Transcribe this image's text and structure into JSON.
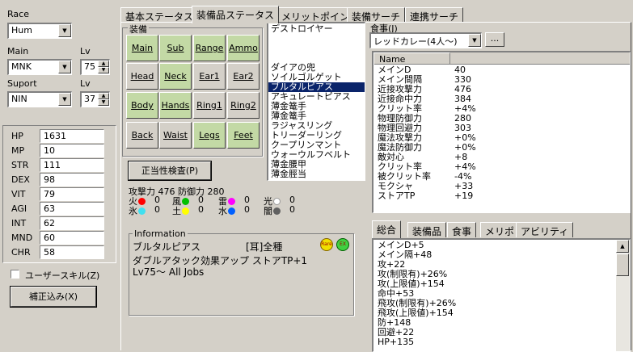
{
  "left": {
    "race_label": "Race",
    "race_value": "Hum",
    "main_label": "Main",
    "main_value": "MNK",
    "main_lv_label": "Lv",
    "main_lv_value": "75",
    "support_label": "Suport",
    "support_value": "NIN",
    "support_lv_label": "Lv",
    "support_lv_value": "37",
    "stats": [
      {
        "name": "HP",
        "value": "1631"
      },
      {
        "name": "MP",
        "value": "10"
      },
      {
        "name": "STR",
        "value": "111"
      },
      {
        "name": "DEX",
        "value": "98"
      },
      {
        "name": "VIT",
        "value": "79"
      },
      {
        "name": "AGI",
        "value": "63"
      },
      {
        "name": "INT",
        "value": "62"
      },
      {
        "name": "MND",
        "value": "60"
      },
      {
        "name": "CHR",
        "value": "58"
      }
    ],
    "user_skill_label": "ユーザースキル(Z)",
    "correction_button": "補正込み(X)"
  },
  "tabs": [
    "基本ステータス",
    "装備品ステータス",
    "メリットポイント",
    "装備サーチ",
    "連携サーチ"
  ],
  "equip": {
    "group_label": "装備",
    "slots": [
      {
        "label": "Main",
        "state": "equipped"
      },
      {
        "label": "Sub",
        "state": "equipped"
      },
      {
        "label": "Range",
        "state": "equipped"
      },
      {
        "label": "Ammo",
        "state": "equipped"
      },
      {
        "label": "Head",
        "state": "empty"
      },
      {
        "label": "Neck",
        "state": "equipped"
      },
      {
        "label": "Ear1",
        "state": "empty"
      },
      {
        "label": "Ear2",
        "state": "empty"
      },
      {
        "label": "Body",
        "state": "equipped"
      },
      {
        "label": "Hands",
        "state": "equipped"
      },
      {
        "label": "Ring1",
        "state": "empty"
      },
      {
        "label": "Ring2",
        "state": "empty"
      },
      {
        "label": "Back",
        "state": "empty"
      },
      {
        "label": "Waist",
        "state": "empty"
      },
      {
        "label": "Legs",
        "state": "equipped"
      },
      {
        "label": "Feet",
        "state": "equipped"
      }
    ],
    "check_button": "正当性検査(P)",
    "attack_line": "攻撃力 476 防御力 280",
    "elements": [
      {
        "name": "火",
        "color": "#ff0000",
        "value": "0"
      },
      {
        "name": "風",
        "color": "#00c000",
        "value": "0"
      },
      {
        "name": "雷",
        "color": "#ff00ff",
        "value": "0"
      },
      {
        "name": "光",
        "color": "#ffffff",
        "value": "0"
      },
      {
        "name": "氷",
        "color": "#40e0f0",
        "value": "0"
      },
      {
        "name": "土",
        "color": "#ffff00",
        "value": "0"
      },
      {
        "name": "水",
        "color": "#0060ff",
        "value": "0"
      },
      {
        "name": "闇",
        "color": "#606060",
        "value": "0"
      }
    ]
  },
  "item_list": {
    "items": [
      "デストロイヤー",
      "",
      "",
      "",
      "ダイアの兜",
      "ソイルゴルゲット",
      "ブルタルピアス",
      "アキュレートピアス",
      "薄金篭手",
      "薄金篭手",
      "ラジャスリング",
      "トリーダーリング",
      "クープリンマント",
      "ウォーウルフベルト",
      "薄金腰甲",
      "薄金脛当"
    ],
    "selected_index": 6
  },
  "info": {
    "group_label": "Information",
    "item_name": "ブルタルピアス",
    "slot_tag": "[耳]全種",
    "badge_rare": "Rare",
    "badge_ex": "EX",
    "description": "ダブルアタック効果アップ ストアTP+1",
    "jobs": "Lv75〜 All Jobs"
  },
  "food": {
    "label": "食事(J)",
    "value": "レッドカレー(4人〜)",
    "button": "..."
  },
  "status_table": {
    "header": "Name",
    "rows": [
      {
        "name": "メインD",
        "value": "40"
      },
      {
        "name": "メイン間隔",
        "value": "330"
      },
      {
        "name": "近接攻撃力",
        "value": "476"
      },
      {
        "name": "近接命中力",
        "value": "384"
      },
      {
        "name": "クリット率",
        "value": "+4%"
      },
      {
        "name": "物理防御力",
        "value": "280"
      },
      {
        "name": "物理回避力",
        "value": "303"
      },
      {
        "name": "魔法攻撃力",
        "value": "+0%"
      },
      {
        "name": "魔法防御力",
        "value": "+0%"
      },
      {
        "name": "敵対心",
        "value": "+8"
      },
      {
        "name": "クリット率",
        "value": "+4%"
      },
      {
        "name": "被クリット率",
        "value": "-4%"
      },
      {
        "name": "モクシャ",
        "value": "+33"
      },
      {
        "name": "ストアTP",
        "value": "+19"
      }
    ]
  },
  "bottom_tabs": [
    "総合",
    "装備品",
    "食事",
    "メリポ",
    "アビリティ"
  ],
  "summary_lines": [
    "メインD+5",
    "メイン隔+48",
    "攻+22",
    "攻(制限有)+26%",
    "攻(上限値)+154",
    "命中+53",
    "飛攻(制限有)+26%",
    "飛攻(上限値)+154",
    "防+148",
    "回避+22",
    "HP+135"
  ]
}
